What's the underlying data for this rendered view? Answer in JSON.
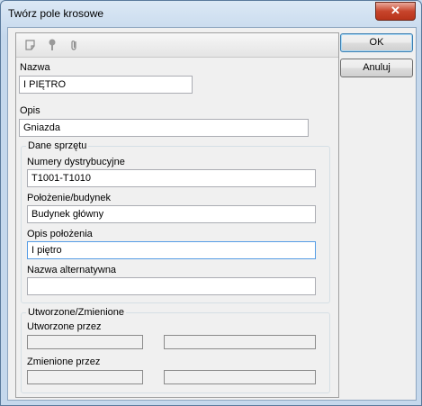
{
  "window": {
    "title": "Twórz pole krosowe",
    "close_symbol": "✕"
  },
  "buttons": {
    "ok": "OK",
    "cancel": "Anuluj"
  },
  "toolbar": {
    "icons": [
      "note-icon",
      "pushpin-icon",
      "paperclip-icon"
    ]
  },
  "form": {
    "name_label": "Nazwa",
    "name_value": "I PIĘTRO",
    "description_label": "Opis",
    "description_value": "Gniazda"
  },
  "equipment": {
    "group_title": "Dane sprzętu",
    "numbers_label": "Numery dystrybucyjne",
    "numbers_value": "T1001-T1010",
    "location_label": "Położenie/budynek",
    "location_value": "Budynek główny",
    "location_desc_label": "Opis położenia",
    "location_desc_value": "I piętro",
    "alt_name_label": "Nazwa alternatywna",
    "alt_name_value": ""
  },
  "audit": {
    "group_title": "Utworzone/Zmienione",
    "created_label": "Utworzone przez",
    "created_by": "",
    "created_date": "",
    "modified_label": "Zmienione przez",
    "modified_by": "",
    "modified_date": ""
  }
}
